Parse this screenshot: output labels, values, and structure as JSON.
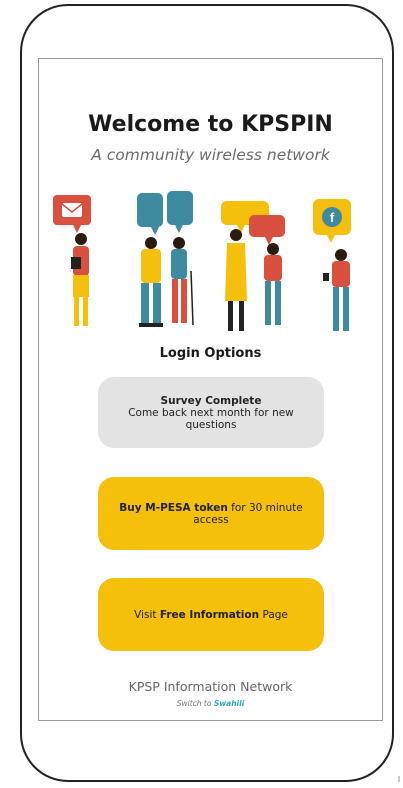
{
  "header": {
    "title": "Welcome to KPSPIN",
    "subtitle": "A community wireless network"
  },
  "section": {
    "heading": "Login Options"
  },
  "cards": {
    "survey": {
      "title": "Survey Complete",
      "detail": "Come back next month for new questions"
    },
    "mpesa": {
      "bold": "Buy M-PESA token",
      "rest": "for 30 minute access"
    },
    "info": {
      "pre": "Visit",
      "bold": "Free Information",
      "post": "Page"
    }
  },
  "footer": {
    "network_name": "KPSP Information Network",
    "switch_prefix": "Switch to",
    "switch_language": "Swahili"
  },
  "colors": {
    "accent": "#f5c00c",
    "disabled_card": "#e3e3e3",
    "link": "#2aa8c0"
  }
}
